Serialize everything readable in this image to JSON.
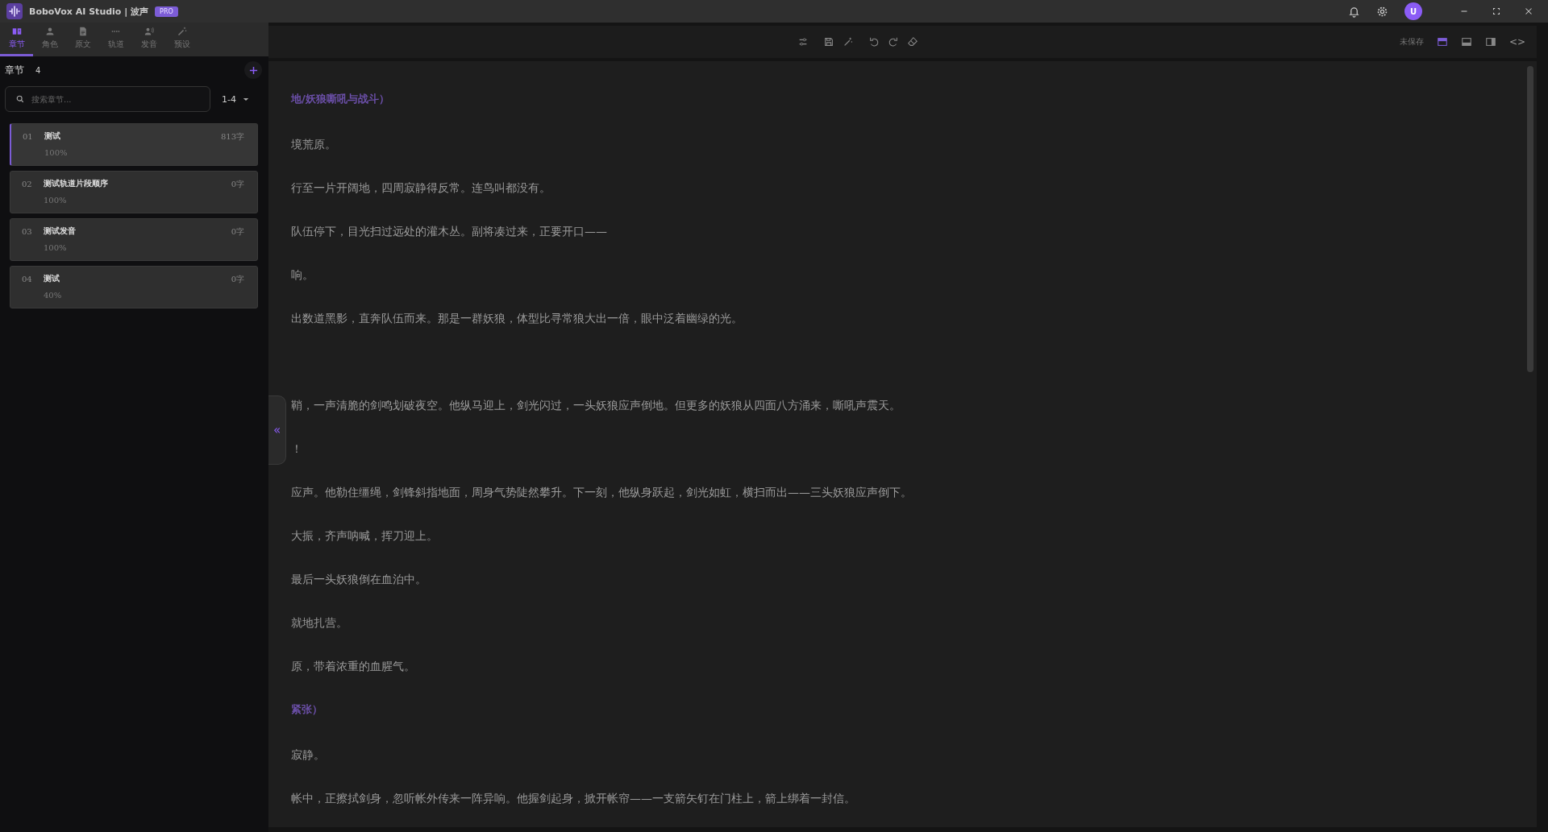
{
  "window": {
    "title": "BoboVox AI Studio | 波声",
    "badge": "PRO",
    "avatar": "U"
  },
  "sidebar": {
    "tabs": [
      {
        "label": "章节",
        "selected": true
      },
      {
        "label": "角色",
        "selected": false
      },
      {
        "label": "原文",
        "selected": false
      },
      {
        "label": "轨道",
        "selected": false
      },
      {
        "label": "发音",
        "selected": false
      },
      {
        "label": "预设",
        "selected": false
      }
    ],
    "header": {
      "title": "章节",
      "count": "4"
    },
    "search": {
      "placeholder": "搜索章节..."
    },
    "range": "1-4",
    "chapters": [
      {
        "number": "01",
        "title": "测试",
        "words": "813字",
        "progress": "100%",
        "selected": true
      },
      {
        "number": "02",
        "title": "测试轨道片段顺序",
        "words": "0字",
        "progress": "100%",
        "selected": false
      },
      {
        "number": "03",
        "title": "测试发音",
        "words": "0字",
        "progress": "100%",
        "selected": false
      },
      {
        "number": "04",
        "title": "测试",
        "words": "0字",
        "progress": "40%",
        "selected": false
      }
    ],
    "collapse": "«"
  },
  "toolbar": {
    "status": "未保存",
    "code": "<>"
  },
  "editor": {
    "paragraphs": [
      {
        "kind": "heading",
        "text": "地/妖狼嘶吼与战斗）"
      },
      {
        "kind": "text",
        "text": "境荒原。"
      },
      {
        "kind": "text",
        "text": "行至一片开阔地，四周寂静得反常。连鸟叫都没有。"
      },
      {
        "kind": "text",
        "text": "队伍停下，目光扫过远处的灌木丛。副将凑过来，正要开口——"
      },
      {
        "kind": "text",
        "text": "响。"
      },
      {
        "kind": "text",
        "text": "出数道黑影，直奔队伍而来。那是一群妖狼，体型比寻常狼大出一倍，眼中泛着幽绿的光。"
      },
      {
        "kind": "blank"
      },
      {
        "kind": "text",
        "text": "鞘，一声清脆的剑鸣划破夜空。他纵马迎上，剑光闪过，一头妖狼应声倒地。但更多的妖狼从四面八方涌来，嘶吼声震天。"
      },
      {
        "kind": "text",
        "text": "！"
      },
      {
        "kind": "text",
        "text": "应声。他勒住缰绳，剑锋斜指地面，周身气势陡然攀升。下一刻，他纵身跃起，剑光如虹，横扫而出——三头妖狼应声倒下。"
      },
      {
        "kind": "text",
        "text": "大振，齐声呐喊，挥刀迎上。"
      },
      {
        "kind": "text",
        "text": "最后一头妖狼倒在血泊中。"
      },
      {
        "kind": "text",
        "text": "就地扎营。"
      },
      {
        "kind": "text",
        "text": "原，带着浓重的血腥气。"
      },
      {
        "kind": "heading",
        "text": "紧张）"
      },
      {
        "kind": "text",
        "text": "寂静。"
      },
      {
        "kind": "text",
        "text": "帐中，正擦拭剑身，忽听帐外传来一阵异响。他握剑起身，掀开帐帘——一支箭矢钉在门柱上，箭上绑着一封信。"
      }
    ]
  }
}
